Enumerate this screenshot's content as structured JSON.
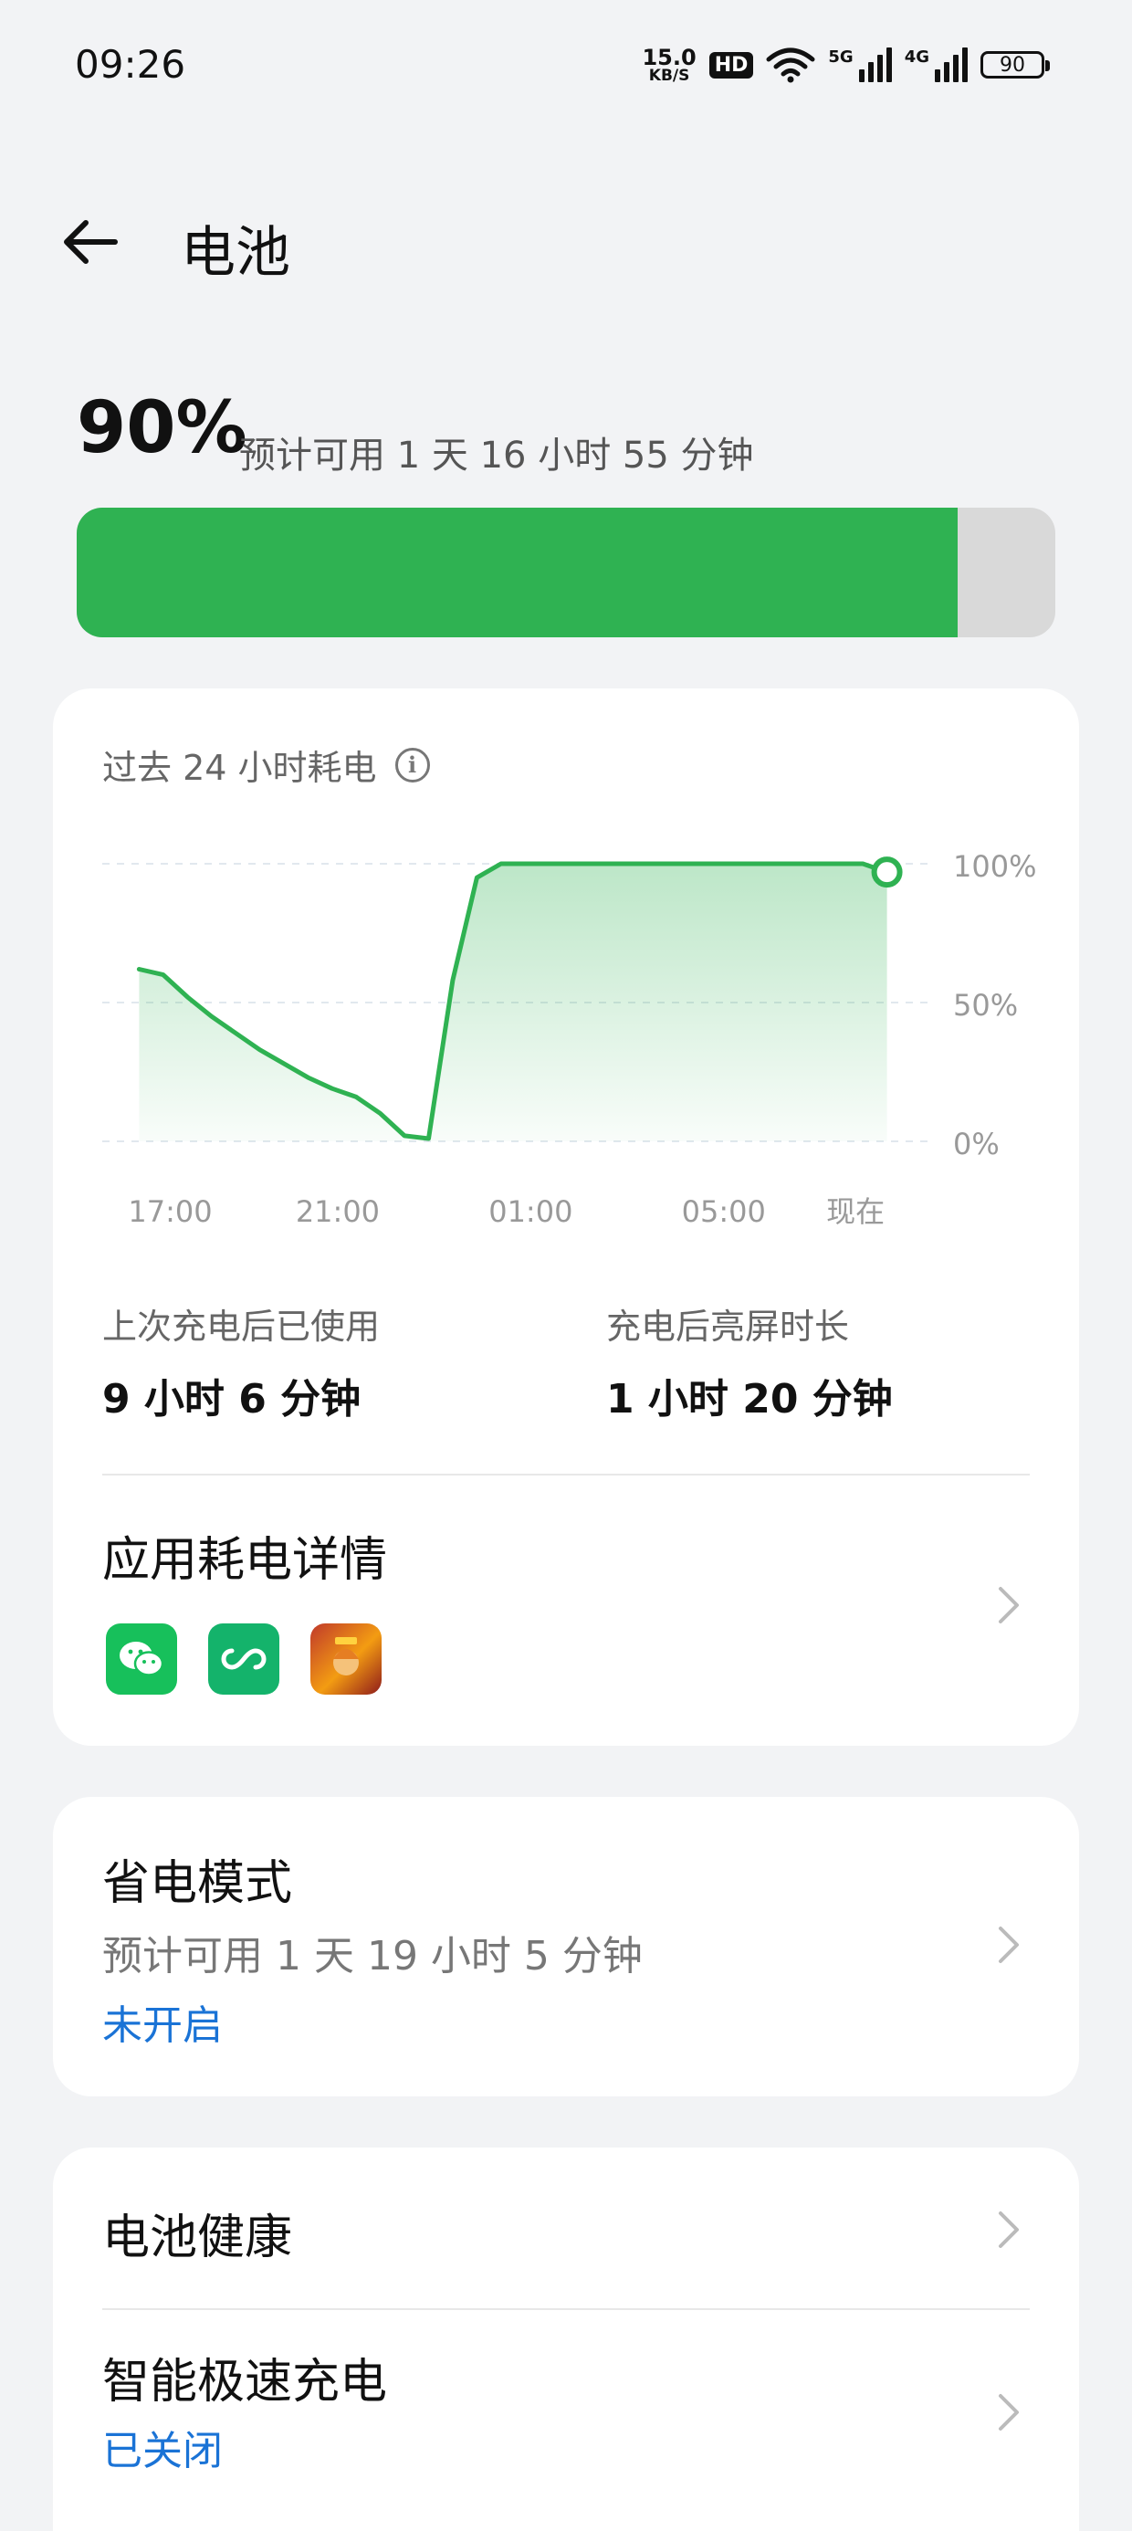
{
  "status_bar": {
    "time": "09:26",
    "net_speed_value": "15.0",
    "net_speed_unit": "KB/S",
    "hd_label": "HD",
    "signal1_label": "5G",
    "signal2_label": "4G",
    "battery_level": "90"
  },
  "header": {
    "back_icon": "arrow-left-icon",
    "title": "电池"
  },
  "battery": {
    "percent_text": "90%",
    "estimate": "预计可用 1 天 16 小时 55 分钟",
    "level_fraction": 0.9,
    "fill_color": "#2fb252",
    "track_color": "#d9d9d9"
  },
  "usage_card": {
    "chart_title": "过去 24 小时耗电",
    "info_icon": "info-icon",
    "stats": [
      {
        "label": "上次充电后已使用",
        "value": "9 小时 6 分钟"
      },
      {
        "label": "充电后亮屏时长",
        "value": "1 小时 20 分钟"
      }
    ],
    "app_section_title": "应用耗电详情",
    "apps": [
      "wechat-icon",
      "infinity-app-icon",
      "game-app-icon"
    ]
  },
  "chart_data": {
    "type": "area",
    "title": "过去 24 小时耗电",
    "x_tick_labels": [
      "17:00",
      "21:00",
      "01:00",
      "05:00",
      "现在"
    ],
    "y_tick_labels": [
      "100%",
      "50%",
      "0%"
    ],
    "ylim": [
      0,
      100
    ],
    "x_hours": [
      0,
      1,
      2,
      3,
      4,
      5,
      6,
      7,
      8,
      9,
      10,
      11,
      12,
      13,
      14,
      15,
      16,
      17
    ],
    "x": [
      17.0,
      17.5,
      18.0,
      18.5,
      19.5,
      20.5,
      21.0,
      21.5,
      22.0,
      22.5,
      23.0,
      23.5,
      24.0,
      24.5,
      25.0,
      29.0,
      32.0,
      32.5
    ],
    "values": [
      62,
      60,
      52,
      45,
      33,
      23,
      19,
      16,
      10,
      2,
      1,
      58,
      95,
      100,
      100,
      100,
      100,
      97
    ],
    "line_color": "#2fb252",
    "grid": true
  },
  "power_saving": {
    "title": "省电模式",
    "estimate": "预计可用 1 天 19 小时 5 分钟",
    "status": "未开启"
  },
  "battery_health": {
    "title": "电池健康"
  },
  "fast_charge": {
    "title": "智能极速充电",
    "status": "已关闭"
  },
  "colors": {
    "accent": "#2fb252",
    "link": "#1a73d6",
    "background": "#f2f3f5",
    "card": "#ffffff"
  }
}
